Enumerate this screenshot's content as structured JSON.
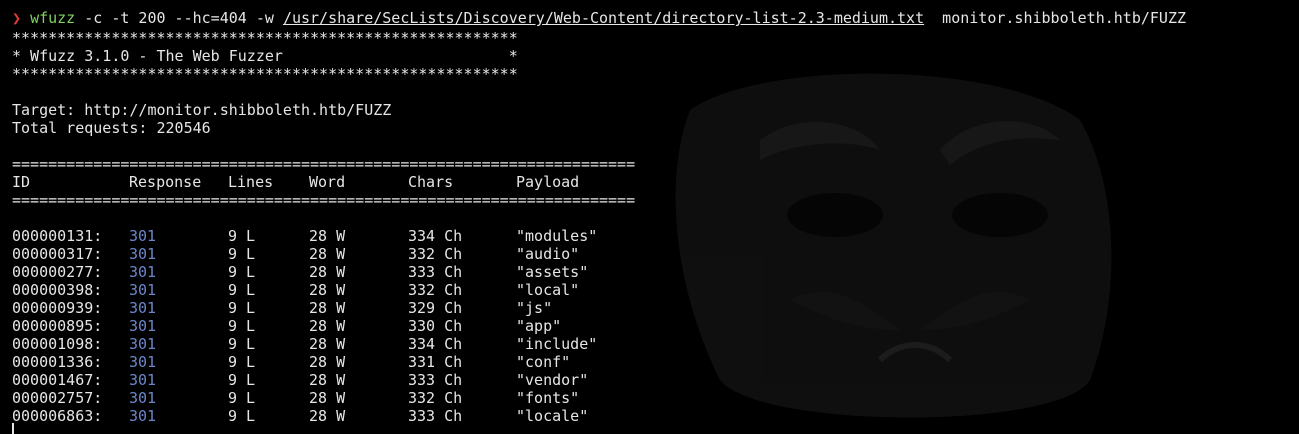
{
  "command": {
    "prompt_symbol": "❯",
    "program": "wfuzz",
    "args_before_path": " -c -t 200 --hc=404 -w ",
    "wordlist_path": "/usr/share/SecLists/Discovery/Web-Content/directory-list-2.3-medium.txt",
    "args_after_path": "  monitor.shibboleth.htb/FUZZ"
  },
  "banner": {
    "border": "********************************************************",
    "title_line": "* Wfuzz 3.1.0 - The Web Fuzzer                         *"
  },
  "summary": {
    "target_line": "Target: http://monitor.shibboleth.htb/FUZZ",
    "total_line": "Total requests: 220546"
  },
  "table": {
    "rule": "=====================================================================",
    "headers": {
      "id": "ID",
      "response": "Response",
      "lines": "Lines",
      "word": "Word",
      "chars": "Chars",
      "payload": "Payload"
    },
    "rows": [
      {
        "id": "000000131:",
        "response": "301",
        "lines": "9 L",
        "word": "28 W",
        "chars": "334 Ch",
        "payload": "\"modules\""
      },
      {
        "id": "000000317:",
        "response": "301",
        "lines": "9 L",
        "word": "28 W",
        "chars": "332 Ch",
        "payload": "\"audio\""
      },
      {
        "id": "000000277:",
        "response": "301",
        "lines": "9 L",
        "word": "28 W",
        "chars": "333 Ch",
        "payload": "\"assets\""
      },
      {
        "id": "000000398:",
        "response": "301",
        "lines": "9 L",
        "word": "28 W",
        "chars": "332 Ch",
        "payload": "\"local\""
      },
      {
        "id": "000000939:",
        "response": "301",
        "lines": "9 L",
        "word": "28 W",
        "chars": "329 Ch",
        "payload": "\"js\""
      },
      {
        "id": "000000895:",
        "response": "301",
        "lines": "9 L",
        "word": "28 W",
        "chars": "330 Ch",
        "payload": "\"app\""
      },
      {
        "id": "000001098:",
        "response": "301",
        "lines": "9 L",
        "word": "28 W",
        "chars": "334 Ch",
        "payload": "\"include\""
      },
      {
        "id": "000001336:",
        "response": "301",
        "lines": "9 L",
        "word": "28 W",
        "chars": "331 Ch",
        "payload": "\"conf\""
      },
      {
        "id": "000001467:",
        "response": "301",
        "lines": "9 L",
        "word": "28 W",
        "chars": "333 Ch",
        "payload": "\"vendor\""
      },
      {
        "id": "000002757:",
        "response": "301",
        "lines": "9 L",
        "word": "28 W",
        "chars": "332 Ch",
        "payload": "\"fonts\""
      },
      {
        "id": "000006863:",
        "response": "301",
        "lines": "9 L",
        "word": "28 W",
        "chars": "333 Ch",
        "payload": "\"locale\""
      }
    ]
  },
  "colors": {
    "background": "#000000",
    "text": "#e6e6e6",
    "prompt": "#e03a3a",
    "program": "#7fd35f",
    "status_301": "#6c86c7"
  }
}
